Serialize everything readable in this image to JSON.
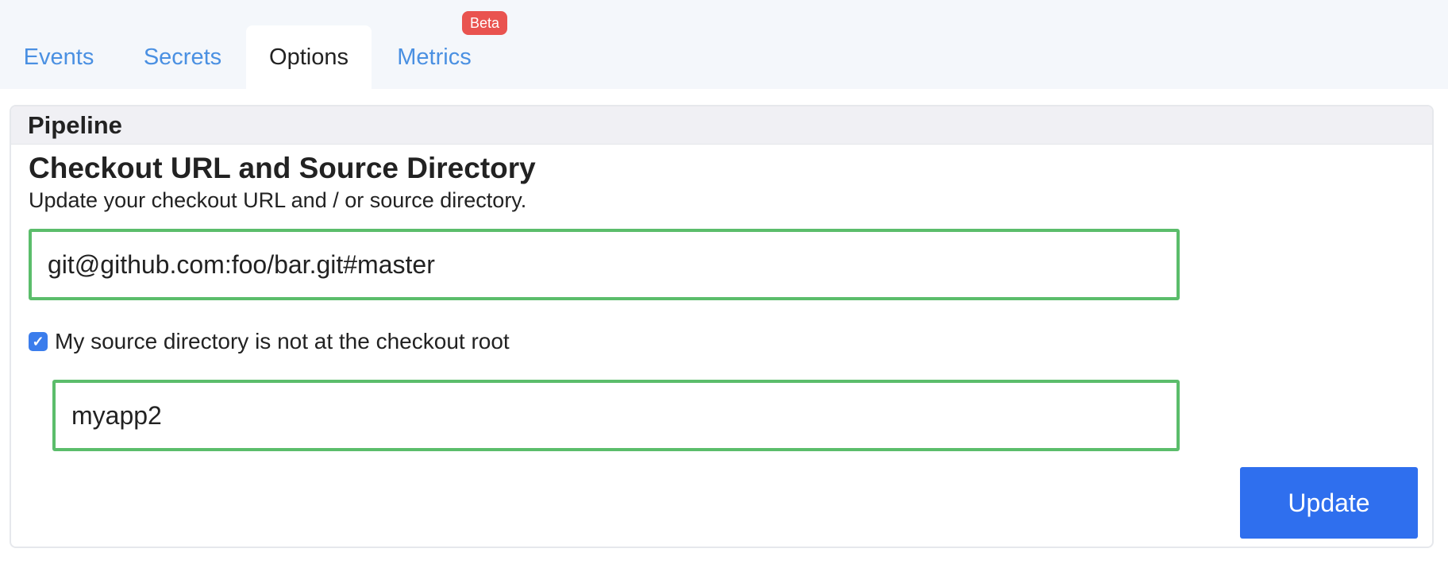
{
  "tabs": [
    {
      "label": "Events"
    },
    {
      "label": "Secrets"
    },
    {
      "label": "Options",
      "active": true
    },
    {
      "label": "Metrics",
      "badge": "Beta"
    }
  ],
  "pipeline": {
    "header": "Pipeline",
    "section_title": "Checkout URL and Source Directory",
    "section_description": "Update your checkout URL and / or source directory.",
    "checkout_url_value": "git@github.com:foo/bar.git#master",
    "source_dir_checkbox": {
      "checked": true,
      "label": "My source directory is not at the checkout root"
    },
    "source_dir_value": "myapp2",
    "update_label": "Update"
  },
  "colors": {
    "tab_link": "#4a90e2",
    "tab_bar_bg": "#f4f7fb",
    "badge": "#e9534f",
    "valid_border": "#5bbd6b",
    "checkbox": "#3b7dec",
    "primary_button": "#2f6fee"
  },
  "icons": {
    "checkbox_checked": "checkmark-icon"
  }
}
